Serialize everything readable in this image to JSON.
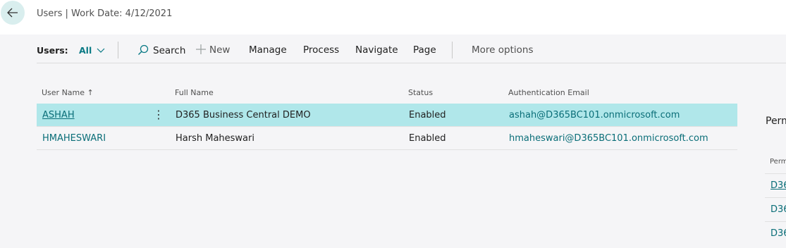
{
  "window": {
    "title": "Users | Work Date: 4/12/2021"
  },
  "actions": {
    "filter_label": "Users:",
    "filter_value": "All",
    "search": "Search",
    "new": "New",
    "manage": "Manage",
    "process": "Process",
    "navigate": "Navigate",
    "page": "Page",
    "more": "More options"
  },
  "table": {
    "columns": [
      "User Name",
      "Full Name",
      "Status",
      "Authentication Email"
    ],
    "sort_indicator": "↑",
    "rows": [
      {
        "user": "ASHAH",
        "full_name": "D365 Business Central DEMO",
        "status": "Enabled",
        "email": "ashah@D365BC101.onmicrosoft.com"
      },
      {
        "user": "HMAHESWARI",
        "full_name": "Harsh Maheswari",
        "status": "Enabled",
        "email": "hmaheswari@D365BC101.onmicrosoft.com"
      }
    ]
  },
  "factbox": {
    "title": "Perm",
    "col_header": "Perm",
    "links": [
      "D36",
      "D36",
      "D36"
    ]
  },
  "colors": {
    "accent": "#0a7a85",
    "selected_row": "#b0e7ea",
    "back_button": "#d9eeee"
  },
  "icons": {
    "back": "arrow-left-icon",
    "search": "search-icon",
    "new": "plus-icon",
    "filter": "chevron-down-icon",
    "row_menu": "vertical-ellipsis-icon"
  }
}
